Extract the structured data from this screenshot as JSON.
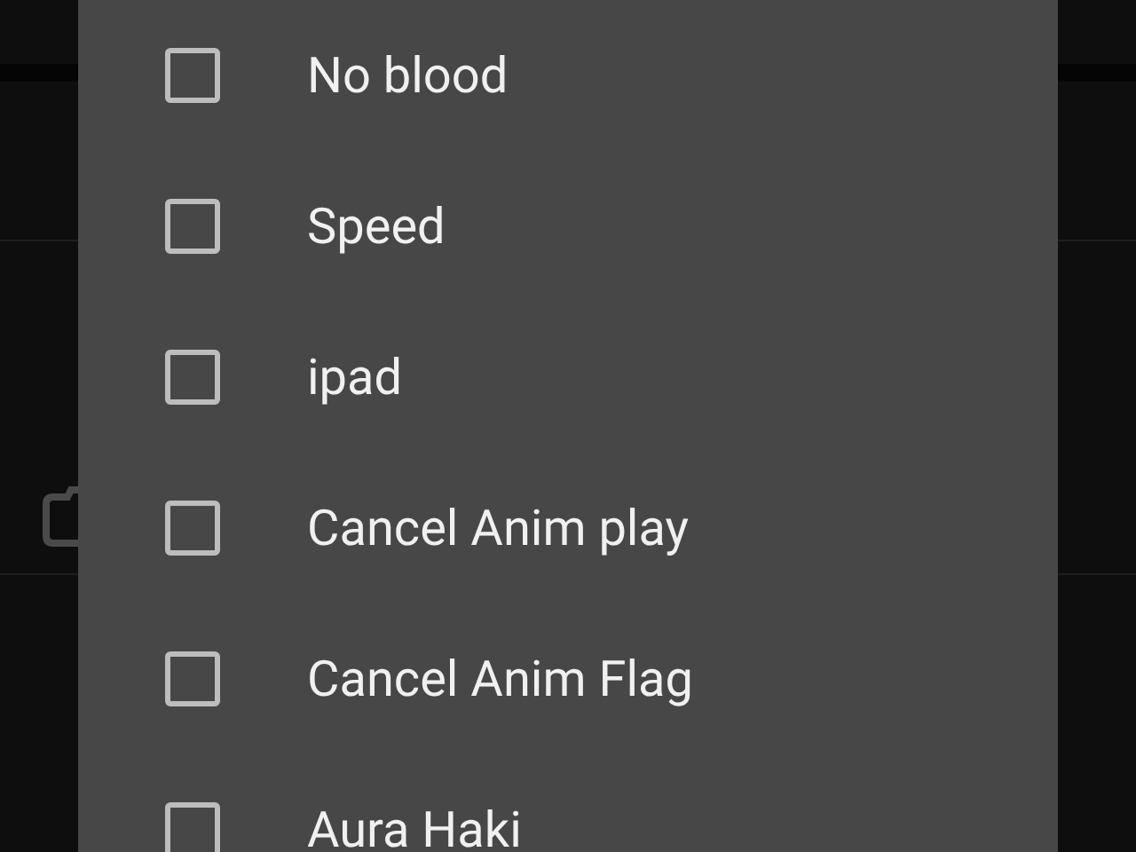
{
  "dialog": {
    "options": [
      {
        "label": "No blood",
        "checked": false
      },
      {
        "label": "Speed",
        "checked": false
      },
      {
        "label": "ipad",
        "checked": false
      },
      {
        "label": "Cancel Anim play",
        "checked": false
      },
      {
        "label": "Cancel Anim Flag",
        "checked": false
      },
      {
        "label": "Aura Haki",
        "checked": false
      }
    ]
  }
}
